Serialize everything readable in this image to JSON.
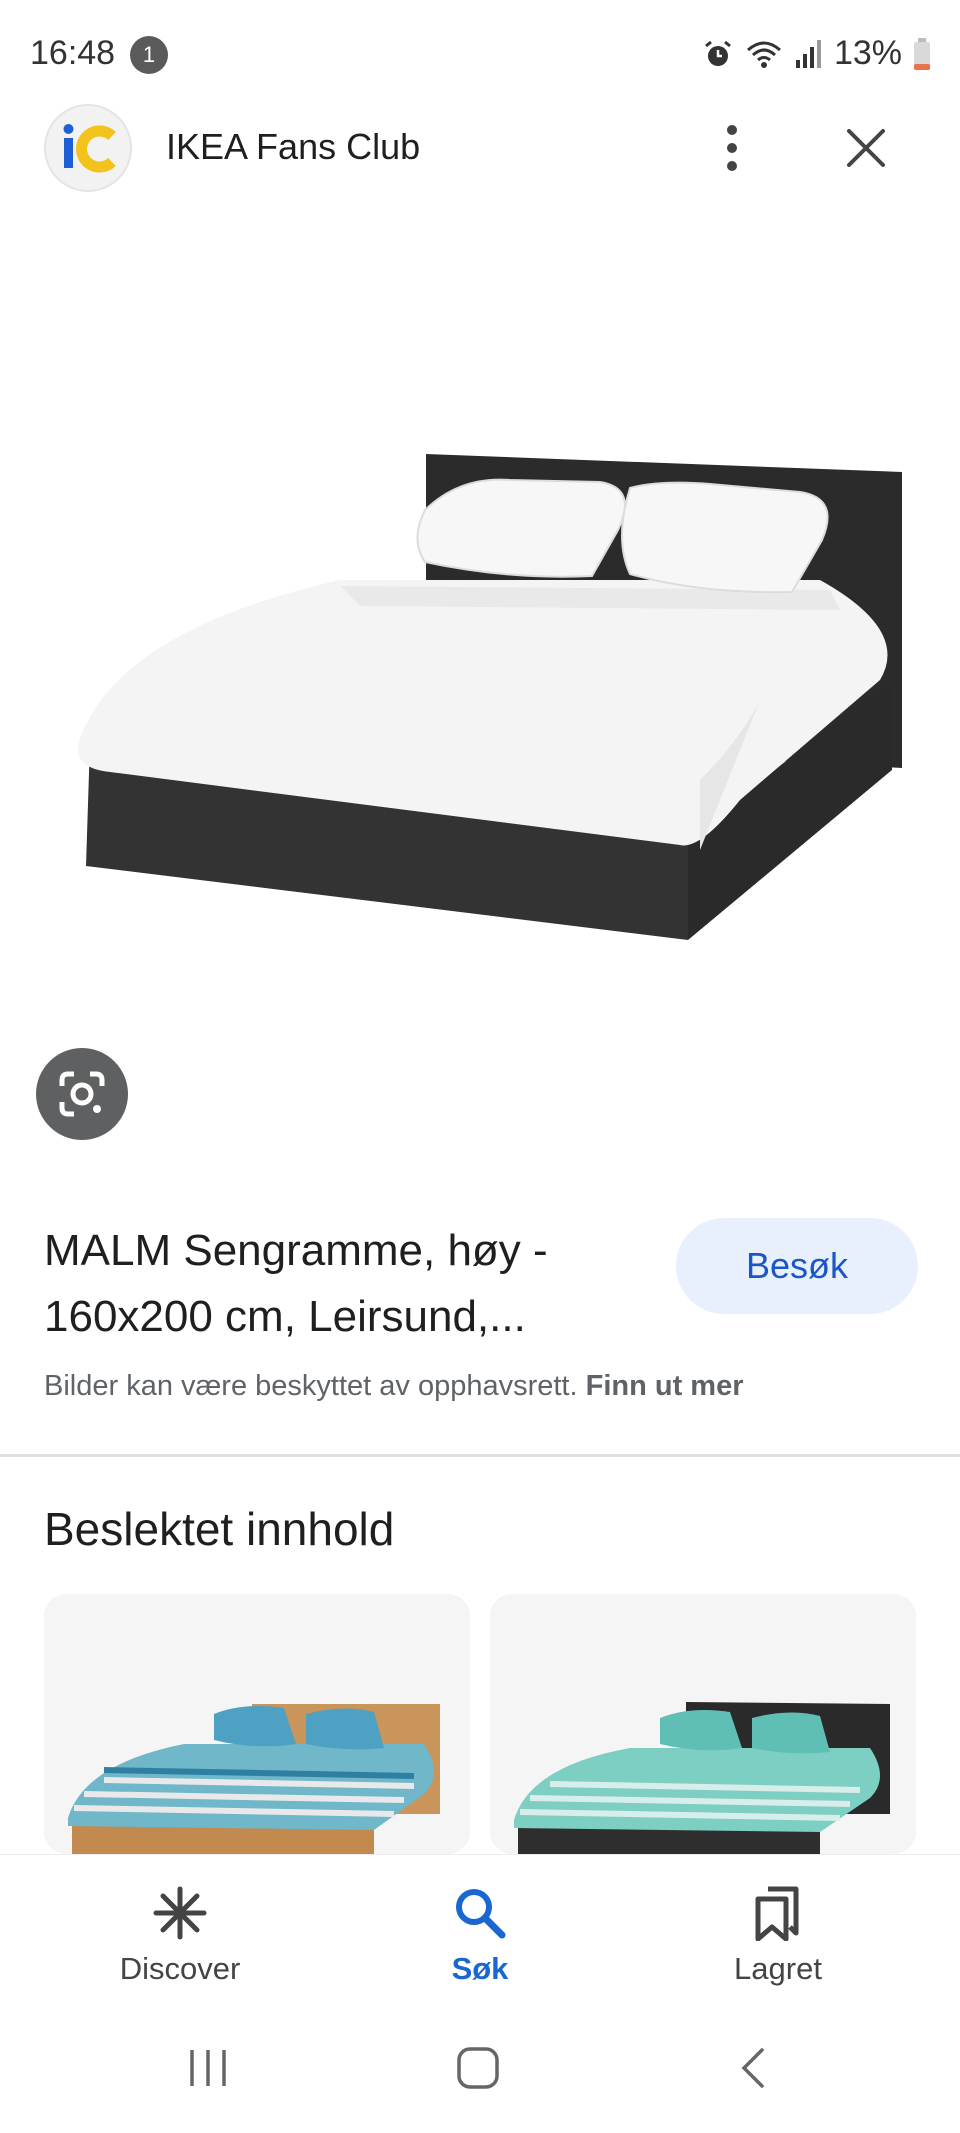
{
  "status_bar": {
    "time": "16:48",
    "notification_count": "1",
    "battery": "13%",
    "icons": [
      "alarm-icon",
      "wifi-icon",
      "signal-icon",
      "battery-icon"
    ]
  },
  "header": {
    "logo_text": "iC",
    "site_name": "IKEA Fans Club",
    "icons": [
      "more-vert-icon",
      "close-icon"
    ]
  },
  "product": {
    "title": "MALM Sengramme, høy - 160x200 cm, Leirsund,...",
    "visit_label": "Besøk",
    "copyright_text": "Bilder kan være beskyttet av opphavsrett.",
    "copyright_link": "Finn ut mer"
  },
  "related": {
    "heading": "Beslektet innhold"
  },
  "bottom_nav": {
    "items": [
      {
        "label": "Discover",
        "icon": "asterisk-icon",
        "active": false
      },
      {
        "label": "Søk",
        "icon": "search-icon",
        "active": true
      },
      {
        "label": "Lagret",
        "icon": "bookmarks-icon",
        "active": false
      }
    ]
  },
  "colors": {
    "accent": "#1a67d2",
    "visit_bg": "#e8f0fd",
    "lens_bg": "#5f6061"
  }
}
